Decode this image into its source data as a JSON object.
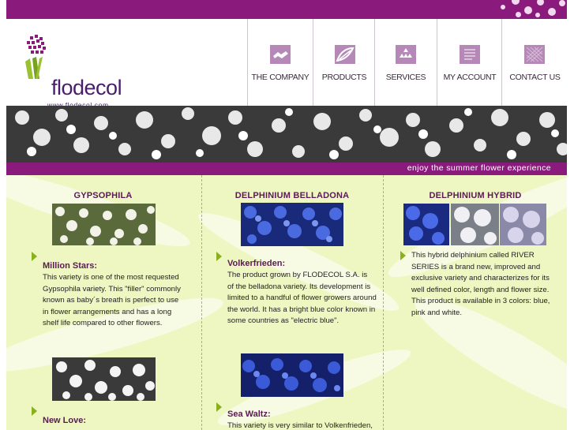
{
  "brand": {
    "name": "flodecol",
    "url": "www.flodecol.com"
  },
  "nav": [
    {
      "label": "THE COMPANY",
      "icon": "handshake-icon"
    },
    {
      "label": "PRODUCTS",
      "icon": "leaf-icon"
    },
    {
      "label": "SERVICES",
      "icon": "triangles-icon"
    },
    {
      "label": "MY ACCOUNT",
      "icon": "document-icon"
    },
    {
      "label": "CONTACT US",
      "icon": "grid-icon"
    }
  ],
  "tagline": "enjoy the summer flower experience",
  "columns": [
    {
      "title": "GYPSOPHILA",
      "items": [
        {
          "title": "Million Stars:",
          "text": [
            "This variety is one of the most requested",
            "Gypsophila variety. This \"filler\" commonly",
            "known as baby´s breath is perfect to use",
            "in flower arrangements and has a long",
            "shelf life compared to other flowers."
          ]
        },
        {
          "title": "New Love:",
          "text": []
        }
      ]
    },
    {
      "title": "DELPHINIUM BELLADONA",
      "items": [
        {
          "title": "Volkerfrieden:",
          "text": [
            "The product grown by FLODECOL S.A. is",
            "of the belladona variety. Its development is",
            "limited to a handful of flower growers around",
            "the world. It has a bright blue color known in",
            "some countries as \"electric blue\"."
          ]
        },
        {
          "title": "Sea Waltz:",
          "text": [
            "This variety is very similar to Volkenfrieden,"
          ]
        }
      ]
    },
    {
      "title": "DELPHINIUM HYBRID",
      "items": [
        {
          "title": "",
          "text": [
            "This hybrid delphinium called RIVER",
            "SERIES is a brand new, improved and",
            "exclusive variety and characterizes for its",
            "well defined color, length and flower size.",
            "This product is available in 3 colors: blue,",
            "pink and white."
          ]
        }
      ]
    }
  ],
  "colors": {
    "brand_purple": "#8a1b7d",
    "content_bg": "#eef7c2",
    "arrow_green": "#8ab020",
    "title_purple": "#5a1a55"
  }
}
